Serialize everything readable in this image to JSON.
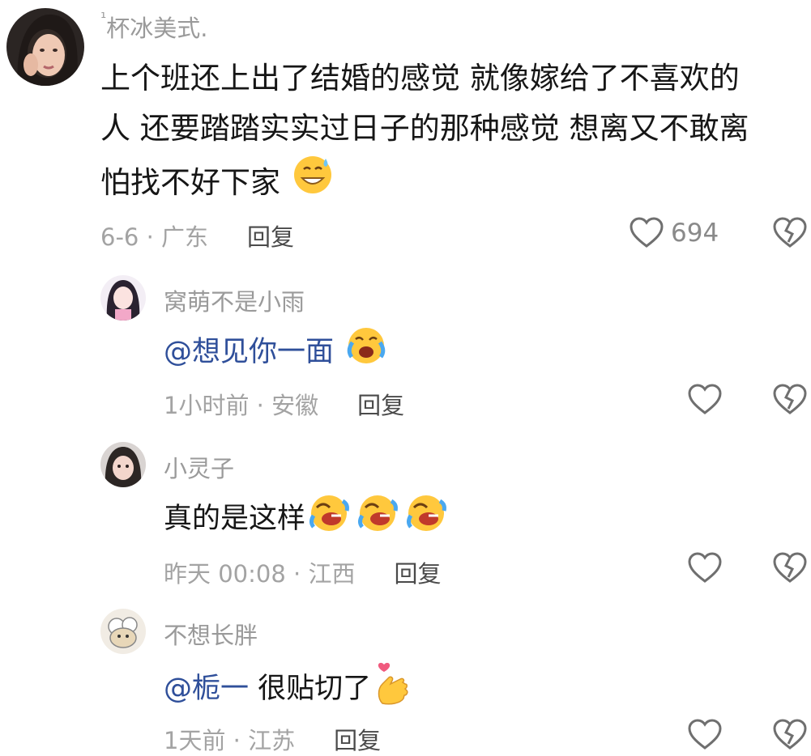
{
  "comment": {
    "author": "杯冰美式.",
    "author_prefix": "¹",
    "text_lines": [
      "上个班还上出了结婚的感觉 就像嫁给了不喜欢的",
      "人 还要踏踏实实过日子的那种感觉 想离又不敢离",
      "怕找不好下家"
    ],
    "emoji": "grinning-sweat-emoji",
    "meta": "6-6 · 广东",
    "reply_label": "回复",
    "like_count": "694"
  },
  "replies": [
    {
      "author": "窝萌不是小雨",
      "mention": "@想见你一面",
      "text": "",
      "emojis": [
        "crying-laughing-emoji"
      ],
      "meta": "1小时前 · 安徽",
      "reply_label": "回复"
    },
    {
      "author": "小灵子",
      "mention": "",
      "text": "真的是这样",
      "emojis": [
        "rofl-emoji",
        "rofl-emoji",
        "rofl-emoji"
      ],
      "meta": "昨天 00:08 · 江西",
      "reply_label": "回复"
    },
    {
      "author": "不想长胖",
      "mention": "@栀一",
      "text": " 很贴切了",
      "emojis": [
        "finger-heart-emoji"
      ],
      "meta": "1天前 · 江苏",
      "reply_label": "回复"
    }
  ],
  "icons": {
    "like": "heart-outline-icon",
    "dislike": "broken-heart-icon"
  },
  "colors": {
    "text": "#161616",
    "muted": "#a3a3a3",
    "mention": "#2f4f9a",
    "emoji_yellow": "#ffc83d"
  }
}
